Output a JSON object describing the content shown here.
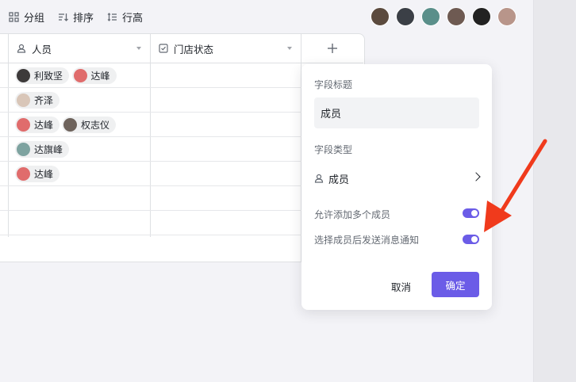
{
  "toolbar": {
    "group_label": "分组",
    "sort_label": "排序",
    "row_height_label": "行高"
  },
  "collaborators": [
    {
      "name": "avatar-1",
      "color": "#5b4a3e"
    },
    {
      "name": "avatar-2",
      "color": "#3b3f46"
    },
    {
      "name": "avatar-3",
      "color": "#5a8f8a"
    },
    {
      "name": "avatar-4",
      "color": "#6e5a52"
    },
    {
      "name": "avatar-5",
      "color": "#222222"
    },
    {
      "name": "avatar-6",
      "color": "#b8958a"
    }
  ],
  "table": {
    "columns": [
      {
        "label": "人员",
        "icon": "person-icon"
      },
      {
        "label": "门店状态",
        "icon": "checkbox-icon"
      }
    ],
    "rows": [
      {
        "people": [
          {
            "name": "利致坚",
            "color": "#3d3a3a"
          },
          {
            "name": "达峰",
            "color": "#e06c6c"
          }
        ]
      },
      {
        "people": [
          {
            "name": "齐泽",
            "color": "#d9c6b8"
          }
        ]
      },
      {
        "people": [
          {
            "name": "达峰",
            "color": "#e06c6c"
          },
          {
            "name": "权志仪",
            "color": "#6e635c"
          }
        ]
      },
      {
        "people": [
          {
            "name": "达旗峰",
            "color": "#7ea3a0"
          }
        ]
      },
      {
        "people": [
          {
            "name": "达峰",
            "color": "#e06c6c"
          }
        ]
      },
      {
        "people": []
      },
      {
        "people": []
      }
    ]
  },
  "panel": {
    "field_title_label": "字段标题",
    "field_title_value": "成员",
    "field_type_label": "字段类型",
    "field_type_value": "成员",
    "allow_multiple_label": "允许添加多个成员",
    "allow_multiple_on": true,
    "notify_label": "选择成员后发送消息通知",
    "notify_on": true,
    "cancel_label": "取消",
    "confirm_label": "确定"
  },
  "colors": {
    "accent": "#6b5ce7",
    "annotation_arrow": "#f03a1c"
  }
}
